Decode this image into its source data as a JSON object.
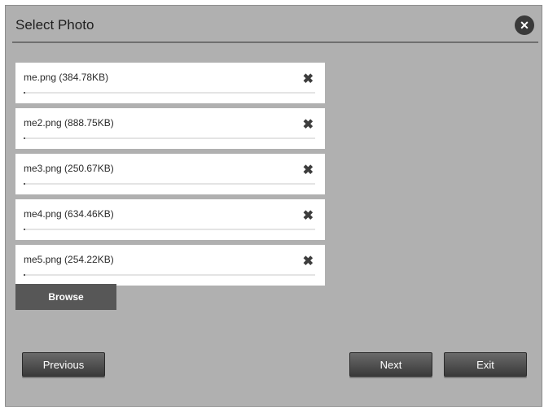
{
  "dialog": {
    "title": "Select Photo",
    "close_glyph": "✕",
    "close_icon": "close-icon"
  },
  "files": [
    {
      "name": "me.png (384.78KB)",
      "progress": 0
    },
    {
      "name": "me2.png (888.75KB)",
      "progress": 0
    },
    {
      "name": "me3.png (250.67KB)",
      "progress": 0
    },
    {
      "name": "me4.png (634.46KB)",
      "progress": 0
    },
    {
      "name": "me5.png (254.22KB)",
      "progress": 0
    }
  ],
  "remove_glyph": "✖",
  "remove_icon": "remove-icon",
  "buttons": {
    "browse": "Browse",
    "previous": "Previous",
    "next": "Next",
    "exit": "Exit"
  }
}
